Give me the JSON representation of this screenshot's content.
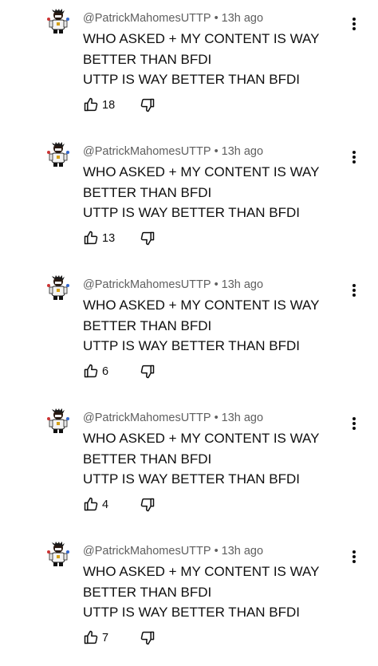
{
  "comments": [
    {
      "author": "@PatrickMahomesUTTP",
      "separator": "•",
      "time": "13h ago",
      "lines": [
        "WHO ASKED + MY CONTENT IS WAY",
        "BETTER THAN BFDI",
        "UTTP IS WAY BETTER THAN BFDI"
      ],
      "likes": "18"
    },
    {
      "author": "@PatrickMahomesUTTP",
      "separator": "•",
      "time": "13h ago",
      "lines": [
        "WHO ASKED + MY CONTENT IS WAY",
        "BETTER THAN BFDI",
        "UTTP IS WAY BETTER THAN BFDI"
      ],
      "likes": "13"
    },
    {
      "author": "@PatrickMahomesUTTP",
      "separator": "•",
      "time": "13h ago",
      "lines": [
        "WHO ASKED + MY CONTENT IS WAY",
        "BETTER THAN BFDI",
        "UTTP IS WAY BETTER THAN BFDI"
      ],
      "likes": "6"
    },
    {
      "author": "@PatrickMahomesUTTP",
      "separator": "•",
      "time": "13h ago",
      "lines": [
        "WHO ASKED + MY CONTENT IS WAY",
        "BETTER THAN BFDI",
        "UTTP IS WAY BETTER THAN BFDI"
      ],
      "likes": "4"
    },
    {
      "author": "@PatrickMahomesUTTP",
      "separator": "•",
      "time": "13h ago",
      "lines": [
        "WHO ASKED + MY CONTENT IS WAY",
        "BETTER THAN BFDI",
        "UTTP IS WAY BETTER THAN BFDI"
      ],
      "likes": "7"
    }
  ],
  "icons": {
    "like": "thumb-up-icon",
    "dislike": "thumb-down-icon",
    "more": "more-vert-icon",
    "avatar": "avatar"
  },
  "colors": {
    "text": "#0f0f0f",
    "meta": "#606060",
    "background": "#ffffff"
  }
}
